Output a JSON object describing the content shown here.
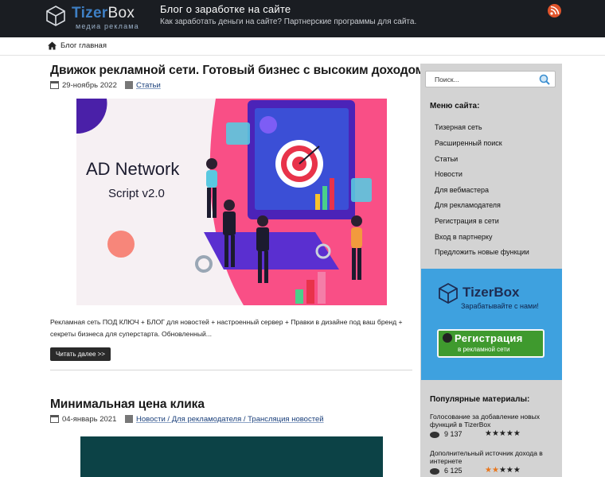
{
  "header": {
    "logo_brand_1": "Tizer",
    "logo_brand_2": "Box",
    "logo_sub": "медиа реклама",
    "site_title": "Блог о заработке на сайте",
    "tagline": "Как заработать деньги на сайте? Партнерские программы для сайта."
  },
  "breadcrumb": {
    "home": "Блог главная"
  },
  "posts": [
    {
      "title": "Движок рекламной сети. Готовый бизнес с высоким доходом",
      "date": "29-ноябрь 2022",
      "categories": "Статьи",
      "image_text_1": "AD Network",
      "image_text_2": "Script v2.0",
      "excerpt": "Рекламная сеть ПОД КЛЮЧ + БЛОГ для новостей + настроенный сервер + Правки в дизайне под ваш бренд + секреты бизнеса для суперстарта. Обновленный...",
      "read_more": "Читать далее >>"
    },
    {
      "title": "Минимальная цена клика",
      "date": "04-январь 2021",
      "categories": "Новости / Для рекламодателя / Трансляция новостей"
    }
  ],
  "sidebar": {
    "search_placeholder": "Поиск...",
    "menu_title": "Меню сайта:",
    "menu": [
      "Тизерная сеть",
      "Расширенный поиск",
      "Статьи",
      "Новости",
      "Для вебмастера",
      "Для рекламодателя",
      "Регистрация в сети",
      "Вход в партнерку",
      "Предложить новые функции"
    ],
    "banner": {
      "name": "TizerBox",
      "slogan": "Зарабатывайте с нами!",
      "cta_main": "Регистрация",
      "cta_sub": "в рекламной сети"
    },
    "popular_title": "Популярные материалы:",
    "popular": [
      {
        "title": "Голосование за добавление новых функций в TizerBox",
        "views": "9 137",
        "rating": 5
      },
      {
        "title": "Дополнительный источник дохода в интернете",
        "views": "6 125",
        "rating": 2
      }
    ]
  },
  "colors": {
    "header_bg": "#1a1d22",
    "sidebar_bg": "#d3d3d3",
    "banner_bg": "#3ea1df",
    "cta_green": "#3f9a2e",
    "rss_orange": "#e1542b",
    "link_blue": "#1a3f7a"
  },
  "icons": [
    "cube-logo-icon",
    "rss-icon",
    "home-icon",
    "calendar-icon",
    "folder-icon",
    "search-icon",
    "eye-icon",
    "star-icon"
  ]
}
